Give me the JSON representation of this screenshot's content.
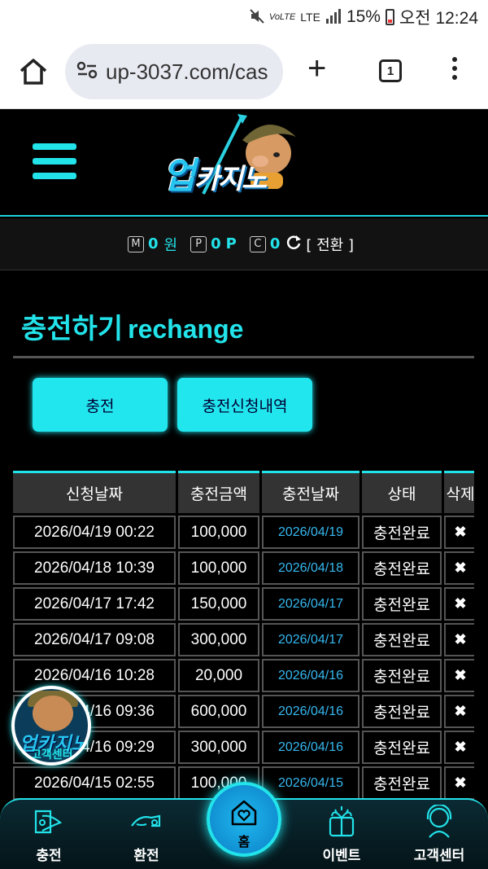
{
  "status": {
    "battery": "15%",
    "time": "오전 12:24",
    "network": "LTE"
  },
  "browser": {
    "url": "up-3037.com/cas",
    "tab_count": "1"
  },
  "header": {
    "logo_main": "업",
    "logo_sub": "카지노"
  },
  "points": {
    "money_label": "M",
    "money_value": "0",
    "money_unit": "원",
    "point_label": "P",
    "point_value": "0",
    "point_unit": "P",
    "coin_label": "C",
    "coin_value": "0",
    "convert_label": "[ 전환 ]"
  },
  "title": {
    "ko": "충전하기",
    "en": "rechange"
  },
  "tabs": {
    "charge": "충전",
    "history": "충전신청내역"
  },
  "table": {
    "headers": [
      "신청날짜",
      "충전금액",
      "충전날짜",
      "상태",
      "삭제"
    ],
    "rows": [
      {
        "requested": "2026/04/19 00:22",
        "amount": "100,000",
        "charged": "2026/04/19",
        "status": "충전완료",
        "delete": "✖"
      },
      {
        "requested": "2026/04/18 10:39",
        "amount": "100,000",
        "charged": "2026/04/18",
        "status": "충전완료",
        "delete": "✖"
      },
      {
        "requested": "2026/04/17 17:42",
        "amount": "150,000",
        "charged": "2026/04/17",
        "status": "충전완료",
        "delete": "✖"
      },
      {
        "requested": "2026/04/17 09:08",
        "amount": "300,000",
        "charged": "2026/04/17",
        "status": "충전완료",
        "delete": "✖"
      },
      {
        "requested": "2026/04/16 10:28",
        "amount": "20,000",
        "charged": "2026/04/16",
        "status": "충전완료",
        "delete": "✖"
      },
      {
        "requested": "2026/04/16 09:36",
        "amount": "600,000",
        "charged": "2026/04/16",
        "status": "충전완료",
        "delete": "✖"
      },
      {
        "requested": "2026/04/16 09:29",
        "amount": "300,000",
        "charged": "2026/04/16",
        "status": "충전완료",
        "delete": "✖"
      },
      {
        "requested": "2026/04/15 02:55",
        "amount": "100,000",
        "charged": "2026/04/15",
        "status": "충전완료",
        "delete": "✖"
      }
    ]
  },
  "badge": {
    "line1": "업카지노",
    "line2": "고객센터"
  },
  "nav": {
    "charge": "충전",
    "exchange": "환전",
    "home": "홈",
    "event": "이벤트",
    "support": "고객센터"
  },
  "colors": {
    "accent": "#22e3ea",
    "date_link": "#36b8f0",
    "background": "#000000"
  }
}
